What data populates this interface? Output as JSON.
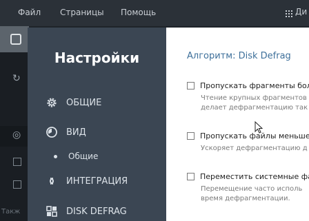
{
  "menubar": {
    "items": [
      "Файл",
      "Страницы",
      "Помощь"
    ],
    "right_label": "Ди"
  },
  "sidebar_bottom_text": "Такж",
  "settings": {
    "title": "Настройки",
    "nav": [
      {
        "label": "ОБЩИЕ",
        "icon": "gear-icon"
      },
      {
        "label": "ВИД",
        "icon": "view-icon"
      },
      {
        "label": "ИНТЕГРАЦИЯ",
        "icon": "integration-icon"
      },
      {
        "label": "DISK DEFRAG",
        "icon": "disk-defrag-icon"
      }
    ],
    "nav_sub": [
      "Общие"
    ]
  },
  "panel": {
    "algorithm_title": "Алгоритм: Disk Defrag",
    "options": [
      {
        "label": "Пропускать фрагменты бол",
        "checked": false,
        "description": [
          "Чтение крупных фрагментов",
          "делает дефрагментацию так"
        ]
      },
      {
        "label": "Пропускать файлы меньше,",
        "checked": false,
        "description": [
          "Ускоряет дефрагментацию д"
        ]
      },
      {
        "label": "Переместить системные фа",
        "checked": false,
        "description": [
          "Перемещение часто исполь",
          "время дефрагментации."
        ]
      }
    ]
  },
  "colors": {
    "nav_bg": "#3b4653",
    "panel_bg": "#ffffff",
    "accent": "#3d6f9a",
    "app_bg": "#1e2329"
  }
}
